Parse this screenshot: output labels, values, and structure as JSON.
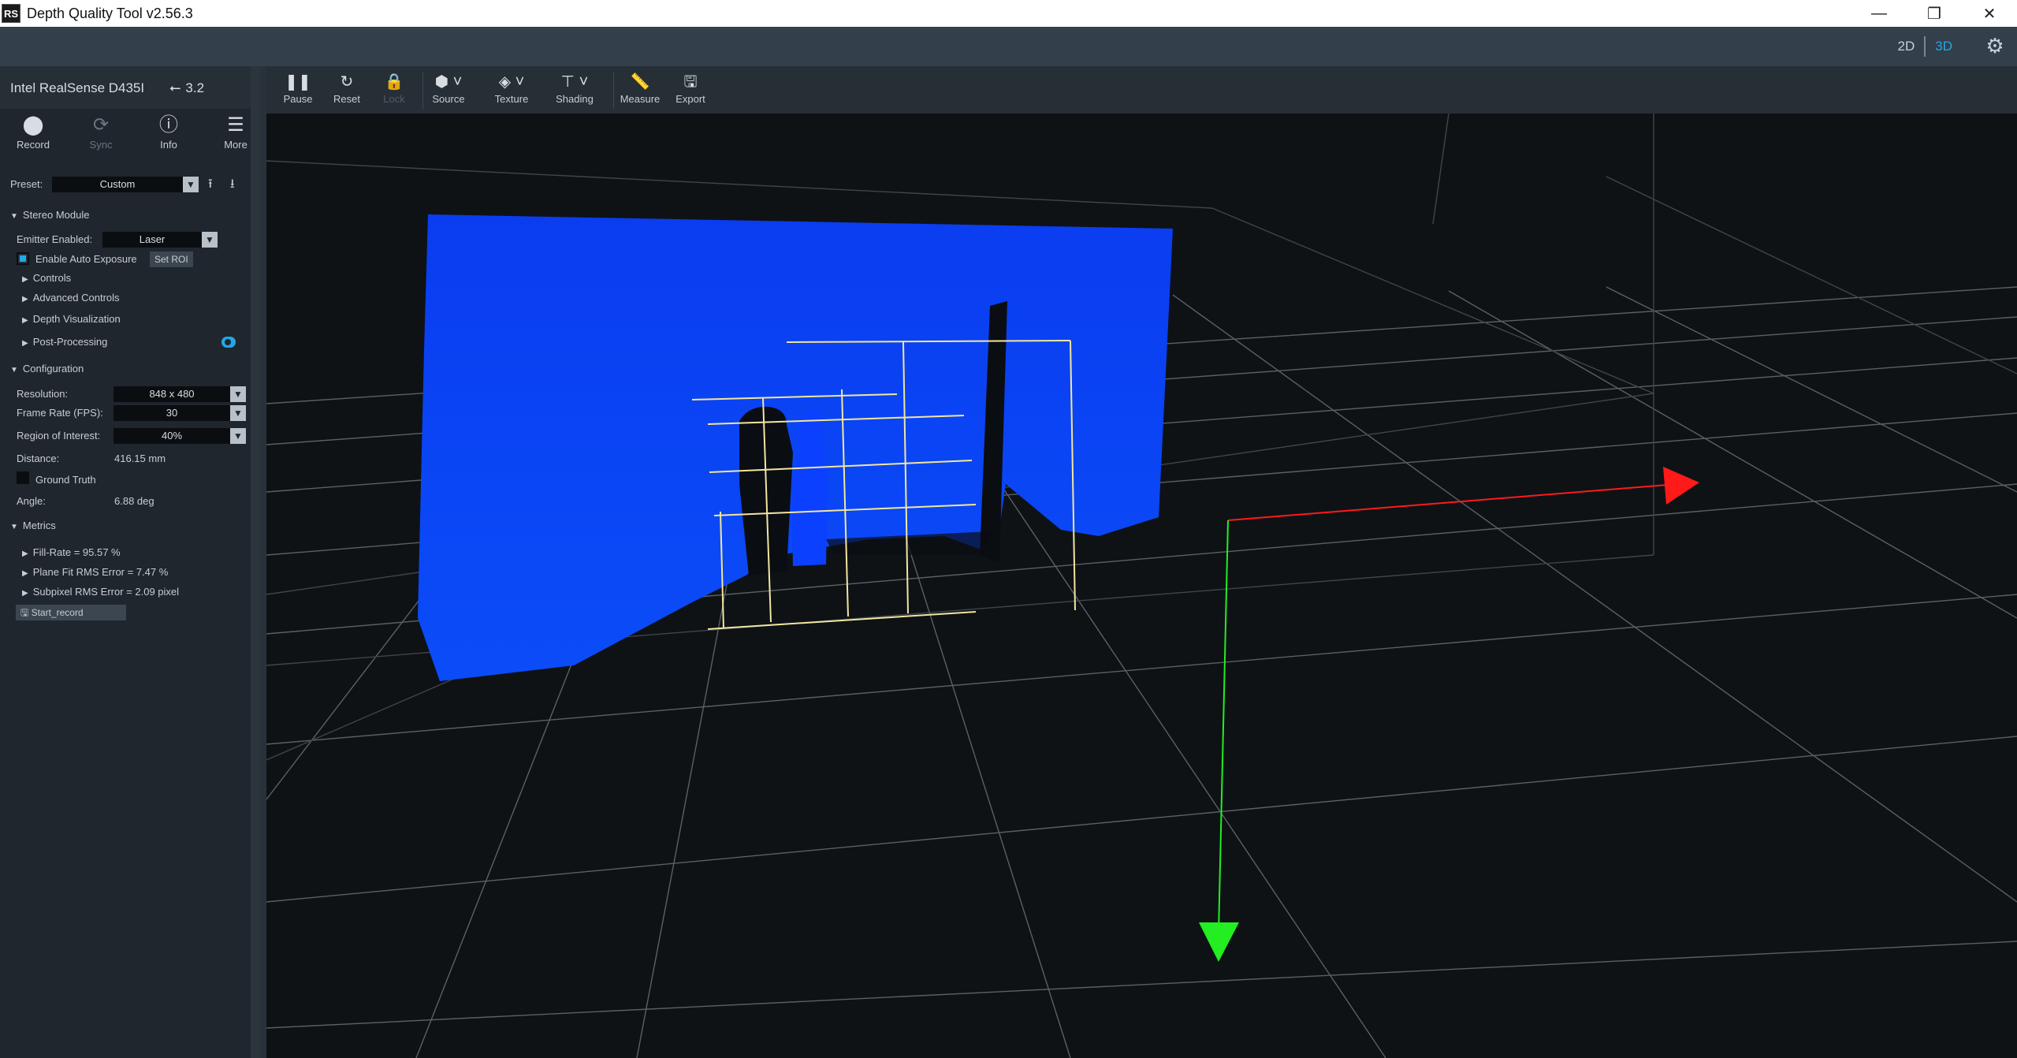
{
  "window": {
    "icon_text": "RS",
    "title": "Depth Quality Tool v2.56.3",
    "minimize": "—",
    "restore": "❐",
    "close": "✕"
  },
  "topbar": {
    "view_2d": "2D",
    "view_3d": "3D",
    "active_view": "3D",
    "settings_icon": "gear-icon"
  },
  "device": {
    "name": "Intel RealSense D435I",
    "usb_icon": "⭠",
    "usb_version": "3.2",
    "buttons": [
      {
        "label": "Record",
        "icon": "record-icon",
        "enabled": true
      },
      {
        "label": "Sync",
        "icon": "sync-icon",
        "enabled": false
      },
      {
        "label": "Info",
        "icon": "info-icon",
        "enabled": true
      },
      {
        "label": "More",
        "icon": "menu-icon",
        "enabled": true
      }
    ]
  },
  "preset": {
    "label": "Preset:",
    "value": "Custom"
  },
  "stereo_module": {
    "title": "Stereo Module",
    "emitter_label": "Emitter Enabled:",
    "emitter_value": "Laser",
    "auto_exposure_label": "Enable Auto Exposure",
    "auto_exposure_checked": true,
    "set_roi": "Set ROI",
    "sections": [
      "Controls",
      "Advanced Controls",
      "Depth Visualization",
      "Post-Processing"
    ],
    "post_processing_enabled": true
  },
  "configuration": {
    "title": "Configuration",
    "resolution_label": "Resolution:",
    "resolution_value": "848 x 480",
    "fps_label": "Frame Rate (FPS):",
    "fps_value": "30",
    "roi_label": "Region of Interest:",
    "roi_value": "40%",
    "distance_label": "Distance:",
    "distance_value": "416.15 mm",
    "ground_truth_label": "Ground Truth",
    "angle_label": "Angle:",
    "angle_value": "6.88 deg"
  },
  "metrics": {
    "title": "Metrics",
    "items": [
      "Fill-Rate = 95.57 %",
      "Plane Fit RMS Error = 7.47 %",
      "Subpixel RMS Error = 2.09 pixel"
    ],
    "record_button": "Start_record"
  },
  "viewer_toolbar": [
    {
      "label": "Pause",
      "icon": "pause-icon",
      "enabled": true
    },
    {
      "label": "Reset",
      "icon": "reset-icon",
      "enabled": true
    },
    {
      "label": "Lock",
      "icon": "lock-icon",
      "enabled": false
    },
    {
      "label": "Source",
      "icon": "cube-icon",
      "enabled": true
    },
    {
      "label": "Texture",
      "icon": "paint-bucket-icon",
      "enabled": true
    },
    {
      "label": "Shading",
      "icon": "paint-roller-icon",
      "enabled": true
    },
    {
      "label": "Measure",
      "icon": "ruler-icon",
      "enabled": true
    },
    {
      "label": "Export",
      "icon": "save-icon",
      "enabled": true
    }
  ],
  "colors": {
    "accent": "#23a8e6",
    "pointcloud": "#0a3df0",
    "axis_x": "#ff1a1a",
    "axis_y": "#22ee22",
    "roi_grid": "#f2e6a0"
  }
}
